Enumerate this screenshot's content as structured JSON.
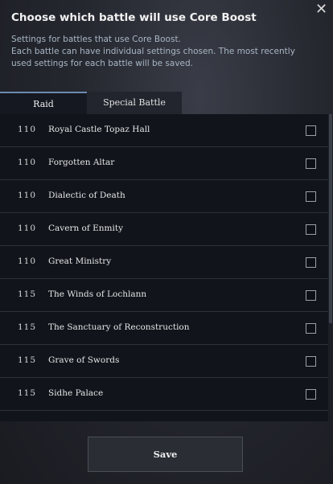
{
  "dialog": {
    "title": "Choose which battle will use Core Boost",
    "description_line1": "Settings for battles that use Core Boost.",
    "description_line2": "Each battle can have individual settings chosen. The most recently used settings for each battle will be saved."
  },
  "tabs": [
    {
      "label": "Raid",
      "active": true
    },
    {
      "label": "Special Battle",
      "active": false
    }
  ],
  "battles": [
    {
      "level": "110",
      "name": "Royal Castle Topaz Hall",
      "checked": false
    },
    {
      "level": "110",
      "name": "Forgotten Altar",
      "checked": false
    },
    {
      "level": "110",
      "name": "Dialectic of Death",
      "checked": false
    },
    {
      "level": "110",
      "name": "Cavern of Enmity",
      "checked": false
    },
    {
      "level": "110",
      "name": "Great Ministry",
      "checked": false
    },
    {
      "level": "115",
      "name": "The Winds of Lochlann",
      "checked": false
    },
    {
      "level": "115",
      "name": "The Sanctuary of Reconstruction",
      "checked": false
    },
    {
      "level": "115",
      "name": "Grave of Swords",
      "checked": false
    },
    {
      "level": "115",
      "name": "Sidhe Palace",
      "checked": false
    }
  ],
  "save_label": "Save",
  "icons": {
    "close": "close-icon"
  }
}
